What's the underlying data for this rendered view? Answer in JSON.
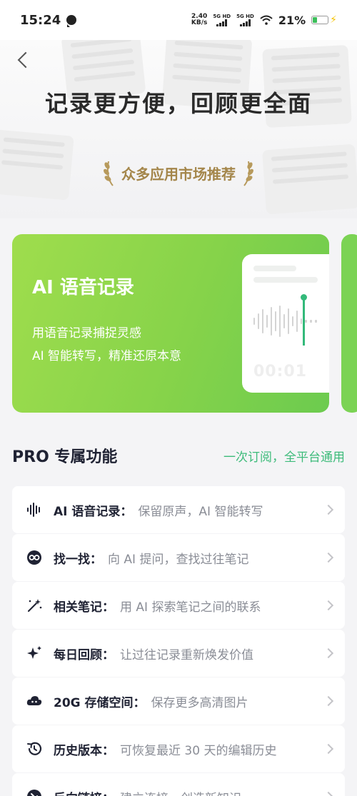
{
  "status": {
    "time": "15:24",
    "speed_value": "2.40",
    "speed_unit": "KB/s",
    "sim1": "5G HD",
    "sim2": "5G HD",
    "battery": "21%"
  },
  "hero": {
    "title": "记录更方便，回顾更全面",
    "badge": "众多应用市场推荐"
  },
  "card": {
    "title": "AI 语音记录",
    "desc_line1": "用语音记录捕捉灵感",
    "desc_line2": "AI 智能转写，精准还原本意",
    "timer": "00:01",
    "accent": "#86d34a"
  },
  "pro": {
    "title": "PRO 专属功能",
    "subtitle": "一次订阅，全平台通用",
    "items": [
      {
        "name": "AI 语音记录：",
        "desc": "保留原声，AI 智能转写",
        "icon": "waveform-icon"
      },
      {
        "name": "找一找：",
        "desc": "向 AI 提问，查找过往笔记",
        "icon": "ai-search-icon"
      },
      {
        "name": "相关笔记：",
        "desc": "用 AI 探索笔记之间的联系",
        "icon": "magic-wand-icon"
      },
      {
        "name": "每日回顾：",
        "desc": "让过往记录重新焕发价值",
        "icon": "sparkle-icon"
      },
      {
        "name": "20G 存储空间：",
        "desc": "保存更多高清图片",
        "icon": "cloud-icon"
      },
      {
        "name": "历史版本：",
        "desc": "可恢复最近 30 天的编辑历史",
        "icon": "history-icon"
      },
      {
        "name": "反向链接：",
        "desc": "建立连接，创造新知识",
        "icon": "backlink-icon"
      }
    ]
  }
}
